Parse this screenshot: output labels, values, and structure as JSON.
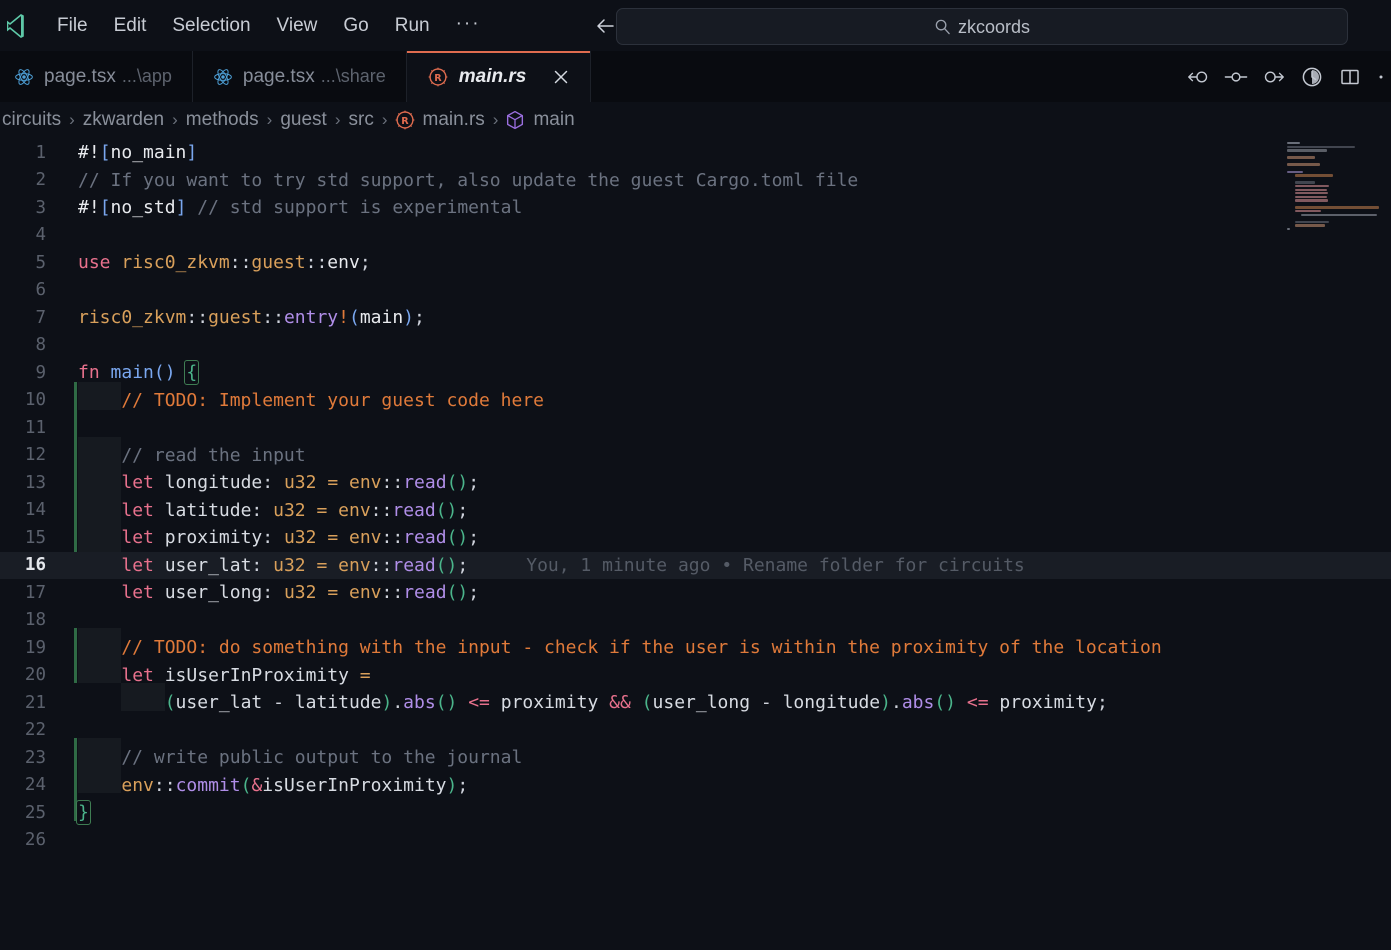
{
  "window": {
    "logo_icon": "vscode-logo-icon"
  },
  "menu": {
    "items": [
      {
        "label": "File",
        "name": "menu-file"
      },
      {
        "label": "Edit",
        "name": "menu-edit"
      },
      {
        "label": "Selection",
        "name": "menu-selection"
      },
      {
        "label": "View",
        "name": "menu-view"
      },
      {
        "label": "Go",
        "name": "menu-go"
      },
      {
        "label": "Run",
        "name": "menu-run"
      },
      {
        "label": "···",
        "name": "menu-more"
      }
    ]
  },
  "navigation": {
    "back_icon": "arrow-left-icon",
    "forward_icon": "arrow-right-icon"
  },
  "search": {
    "icon": "search-icon",
    "value": "zkcoords",
    "placeholder": "Search"
  },
  "tabs": [
    {
      "label": "page.tsx",
      "dim": "...\\app",
      "icon": "react-icon",
      "active": false
    },
    {
      "label": "page.tsx",
      "dim": "...\\share",
      "icon": "react-icon",
      "active": false
    },
    {
      "label": "main.rs",
      "dim": "",
      "icon": "rust-icon",
      "active": true,
      "close_icon": "close-icon"
    }
  ],
  "editor_actions": [
    {
      "name": "git-branch-back-icon",
      "label": "Go Back"
    },
    {
      "name": "git-commit-icon",
      "label": "Commit"
    },
    {
      "name": "git-branch-forward-icon",
      "label": "Go Forward"
    },
    {
      "name": "timeline-clock-icon",
      "label": "Timeline"
    },
    {
      "name": "split-editor-icon",
      "label": "Split Editor Right"
    },
    {
      "name": "more-actions-icon",
      "label": "More Actions..."
    }
  ],
  "breadcrumb": {
    "separator": "›",
    "segments": [
      {
        "label": "circuits",
        "icon": null
      },
      {
        "label": "zkwarden",
        "icon": null
      },
      {
        "label": "methods",
        "icon": null
      },
      {
        "label": "guest",
        "icon": null
      },
      {
        "label": "src",
        "icon": null
      },
      {
        "label": "main.rs",
        "icon": "rust-icon"
      },
      {
        "label": "main",
        "icon": "symbol-function-cube-icon"
      }
    ]
  },
  "blame": {
    "line": 16,
    "text": "You, 1 minute ago • Rename folder for circuits"
  },
  "code": {
    "language": "rust",
    "first_line": 1,
    "last_line": 26,
    "active_line": 16,
    "lines": [
      {
        "n": 1,
        "text": "#![no_main]"
      },
      {
        "n": 2,
        "text": "// If you want to try std support, also update the guest Cargo.toml file"
      },
      {
        "n": 3,
        "text": "#![no_std] // std support is experimental"
      },
      {
        "n": 4,
        "text": ""
      },
      {
        "n": 5,
        "text": "use risc0_zkvm::guest::env;"
      },
      {
        "n": 6,
        "text": ""
      },
      {
        "n": 7,
        "text": "risc0_zkvm::guest::entry!(main);"
      },
      {
        "n": 8,
        "text": ""
      },
      {
        "n": 9,
        "text": "fn main() {"
      },
      {
        "n": 10,
        "text": "    // TODO: Implement your guest code here"
      },
      {
        "n": 11,
        "text": ""
      },
      {
        "n": 12,
        "text": "    // read the input"
      },
      {
        "n": 13,
        "text": "    let longitude: u32 = env::read();"
      },
      {
        "n": 14,
        "text": "    let latitude: u32 = env::read();"
      },
      {
        "n": 15,
        "text": "    let proximity: u32 = env::read();"
      },
      {
        "n": 16,
        "text": "    let user_lat: u32 = env::read();"
      },
      {
        "n": 17,
        "text": "    let user_long: u32 = env::read();"
      },
      {
        "n": 18,
        "text": ""
      },
      {
        "n": 19,
        "text": "    // TODO: do something with the input - check if the user is within the proximity of the location"
      },
      {
        "n": 20,
        "text": "    let isUserInProximity ="
      },
      {
        "n": 21,
        "text": "        (user_lat - latitude).abs() <= proximity && (user_long - longitude).abs() <= proximity;"
      },
      {
        "n": 22,
        "text": ""
      },
      {
        "n": 23,
        "text": "    // write public output to the journal"
      },
      {
        "n": 24,
        "text": "    env::commit(&isUserInProximity);"
      },
      {
        "n": 25,
        "text": "}"
      },
      {
        "n": 26,
        "text": ""
      }
    ]
  },
  "colors": {
    "editor_background": "#0d1017",
    "tabbar_background": "#090b10",
    "active_tab_border": "#e06c4f",
    "active_line": "#191d25",
    "comment": "#6b7280",
    "todo_comment": "#e07a3a",
    "keyword": "#e8718d",
    "function": "#7aa7ef",
    "type": "#d9a05b",
    "method": "#b08ee8",
    "bracket_green": "#4bb58b",
    "bracket_blue": "#7aa7ef",
    "blame_text": "#555b66",
    "line_number": "#5b616d",
    "rust_icon": "#e06c4f",
    "react_icon": "#4d9fd6",
    "symbol_cube": "#9b6fe0"
  },
  "minimap": {
    "name": "minimap",
    "visible": true
  }
}
